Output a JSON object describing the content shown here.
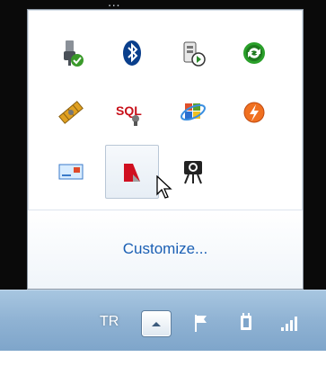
{
  "backdrop_text": "...",
  "flyout": {
    "icons": [
      {
        "name": "usb-safely-remove-icon"
      },
      {
        "name": "bluetooth-icon"
      },
      {
        "name": "media-device-icon"
      },
      {
        "name": "sync-icon"
      },
      {
        "name": "satellite-icon"
      },
      {
        "name": "sql-server-icon"
      },
      {
        "name": "windows-update-icon"
      },
      {
        "name": "flash-icon"
      },
      {
        "name": "messenger-card-icon"
      },
      {
        "name": "kaspersky-icon"
      },
      {
        "name": "webcam-icon"
      }
    ],
    "customize_label": "Customize..."
  },
  "taskbar": {
    "language": "TR",
    "icons": [
      "show-hidden-icons",
      "action-center-flag-icon",
      "power-icon",
      "network-signal-icon"
    ]
  },
  "colors": {
    "link": "#1a5fb4",
    "taskbar": "#8fb2d3"
  }
}
